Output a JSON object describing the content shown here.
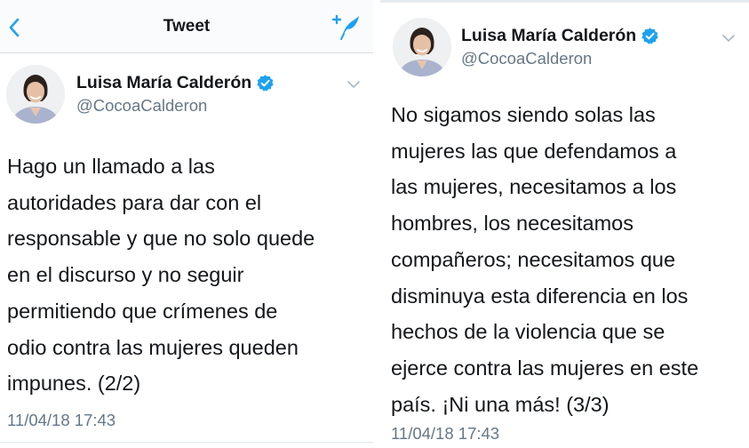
{
  "header": {
    "title": "Tweet",
    "back_icon": "chevron-left-icon",
    "compose_icon": "compose-tweet-icon"
  },
  "colors": {
    "accent": "#1da1f2",
    "text": "#14171a",
    "secondary_text": "#657786",
    "verified": "#1da1f2"
  },
  "tweets": [
    {
      "author_name": "Luisa María Calderón",
      "handle": "@CocoaCalderon",
      "verified": true,
      "lines": [
        "Hago un llamado a las",
        "autoridades para dar con el",
        "responsable y que no solo quede",
        "en el discurso y no seguir",
        "permitiendo que crímenes de",
        "odio contra las mujeres queden",
        "impunes. (2/2)"
      ],
      "timestamp": "11/04/18 17:43"
    },
    {
      "author_name": "Luisa María Calderón",
      "handle": "@CocoaCalderon",
      "verified": true,
      "lines": [
        "No sigamos siendo solas las",
        "mujeres las que defendamos a",
        "las mujeres, necesitamos a los",
        "hombres, los necesitamos",
        "compañeros; necesitamos que",
        "disminuya esta diferencia en los",
        "hechos de la violencia que se",
        "ejerce contra las mujeres en este",
        "país. ¡Ni una más! (3/3)"
      ],
      "timestamp": "11/04/18 17:43"
    }
  ]
}
